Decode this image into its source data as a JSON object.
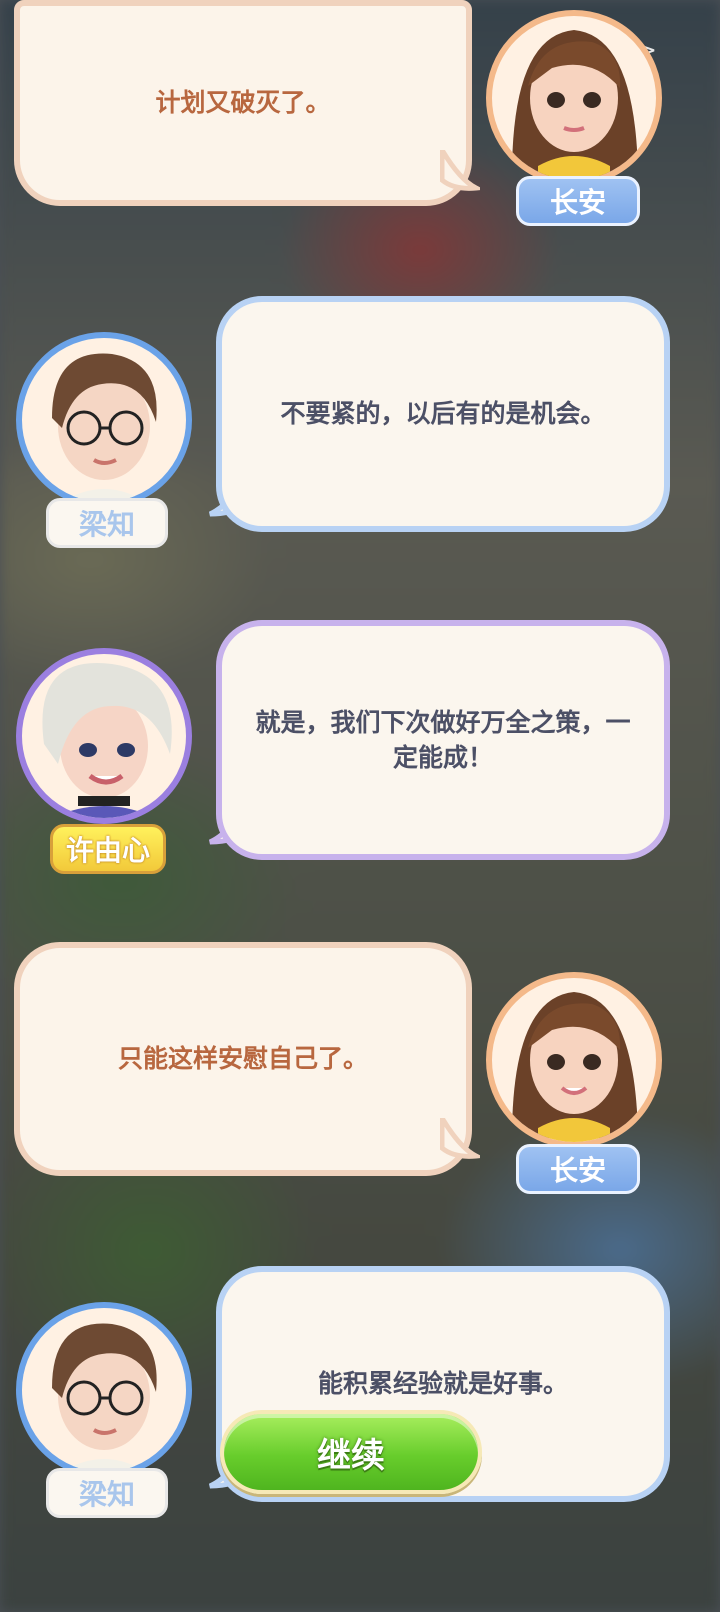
{
  "skip_label": ">>",
  "messages": [
    {
      "speaker": "长安",
      "text": "计划又破灭了。"
    },
    {
      "speaker": "梁知",
      "text": "不要紧的，以后有的是机会。"
    },
    {
      "speaker": "许由心",
      "text": "就是，我们下次做好万全之策，一定能成！"
    },
    {
      "speaker": "长安",
      "text": "只能这样安慰自己了。"
    },
    {
      "speaker": "梁知",
      "text": "能积累经验就是好事。"
    }
  ],
  "continue_label": "继续",
  "colors": {
    "cream_border": "#f0d2bd",
    "blue_border": "#b8d2f4",
    "purple_border": "#c7b2ec",
    "button_green": "#68cd2c"
  }
}
